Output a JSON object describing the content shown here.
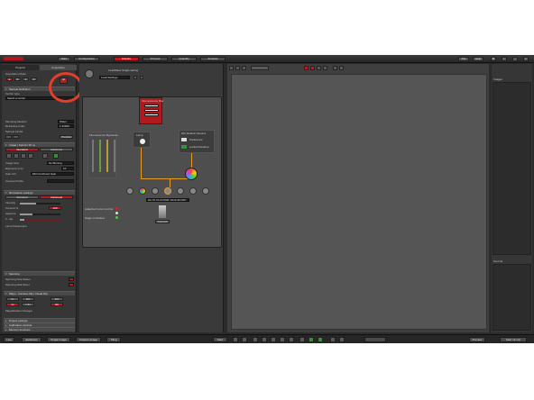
{
  "topbar": {
    "user_label": "Start",
    "mode_tabs": [
      "Configuration",
      "Acquire",
      "Process",
      "Quantify",
      "Analysis"
    ],
    "active_mode": "Acquire",
    "right_buttons": [
      "File",
      "Help"
    ]
  },
  "left_panel": {
    "tabs": [
      "Projects",
      "Acquisition"
    ],
    "active_tab": "Acquisition",
    "acq_mode_label": "Acquisition Mode",
    "sample_definition": {
      "header": "Sample Definition",
      "carrier_type_label": "Carrier type",
      "carrier_value": "Select a carrier",
      "mounting_medium_label": "Mounting Medium",
      "mounting_medium_value": "Water",
      "refractive_index_label": "Refractive Index",
      "refractive_index_value": "1.33000",
      "sample_finder_label": "Sample Finder",
      "preview_label": "Preview"
    },
    "image_section": {
      "header": "Image | Spinnin 20 oo",
      "standard_label": "Standard",
      "advanced_label": "Advanced",
      "image_size_label": "Image Size",
      "image_size_value": "No Binning",
      "exposure_label": "Exposure (ms)",
      "exposure_value": "10",
      "gain_label": "Gain Ctrl",
      "gain_value": "EM Combined Gain",
      "camera_profile_label": "Camera Profile"
    },
    "illumination": {
      "header": "Illumination settings",
      "standard_label": "Standard",
      "advanced_label": "Advanced",
      "intensity_label": "Intensity",
      "camera_label": "Camera %",
      "aperture_label": "Aperture",
      "fstop_label": "F - Ap.",
      "lamp_label": "Lamp Parameters"
    },
    "spinning": {
      "header": "Spinning",
      "disk_status_label": "Spinning Disk Status",
      "disk_motor_label": "Spinning Disk Motor"
    },
    "magnification": {
      "header": "Magn - Camera Obj | Visual Obj",
      "change_label": "Magnification Changer"
    },
    "collapsed": [
      "Project settings",
      "Calibration wizards",
      "Memory functions"
    ]
  },
  "center_panel": {
    "header": "Load/Save Single setting",
    "settings_label": "Load Settings",
    "lamp_label": "Lamp",
    "camera_label": "HIC Default Camera",
    "preference_label": "Preference",
    "locked_label": "Locked Desktop",
    "objective_label": "HC PL FLUOTAR 10x/0.30 DRY",
    "adaptive_focus_label": "Adaptive Focus Control",
    "xy_label": "",
    "stage_label": "Stage controlled",
    "bf_label": "BF",
    "icon_label": "Transmit",
    "filter_title": "Fluorescence filter"
  },
  "viewer": {
    "toolbar_zoom": ""
  },
  "right_panel": {
    "images_label": "Images",
    "tool_label": "Tool Cd"
  },
  "bottom_bar": {
    "buttons": [
      "Live",
      "Autofocus",
      "Single Image",
      "Capture Image",
      "Tiling"
    ],
    "center_buttons": [
      "Start"
    ],
    "right_buttons": [
      "Preview",
      "Start 12 min"
    ]
  }
}
